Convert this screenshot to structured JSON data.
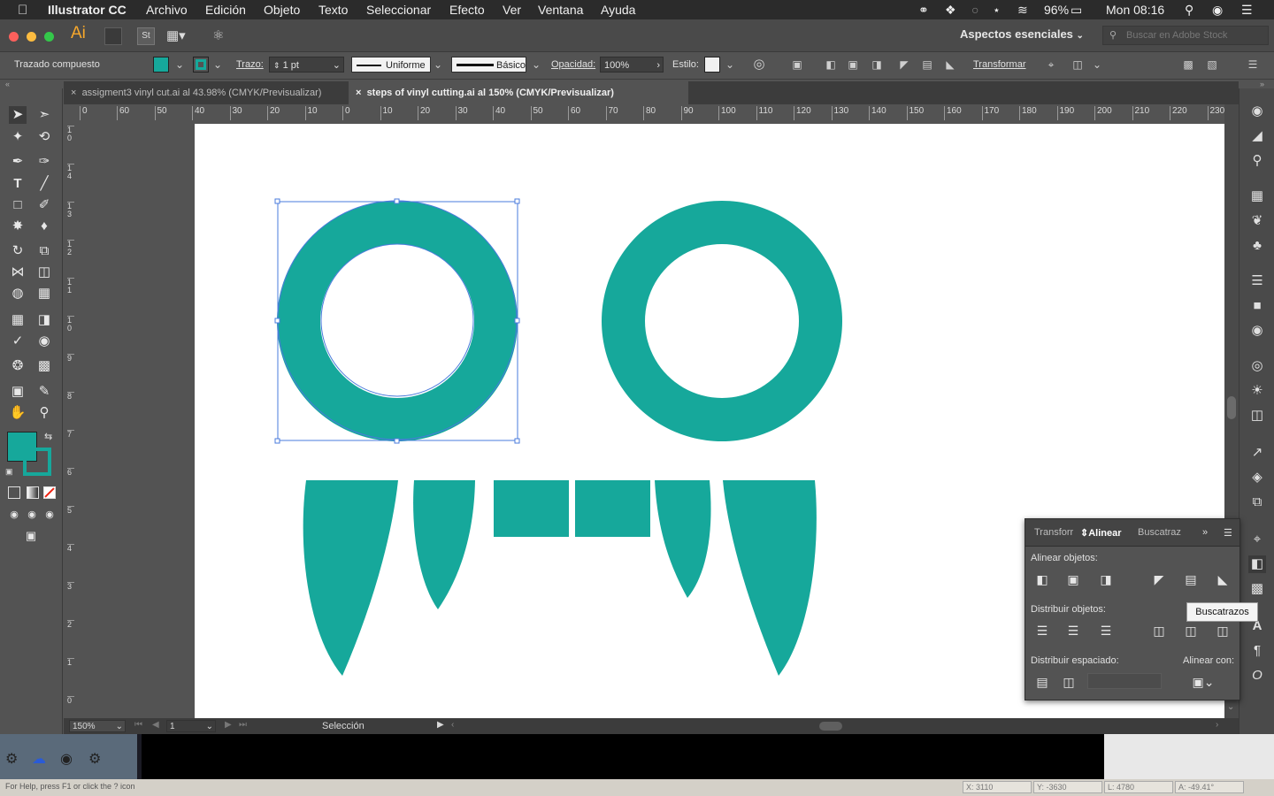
{
  "menubar": {
    "app": "Illustrator CC",
    "items": [
      "Archivo",
      "Edición",
      "Objeto",
      "Texto",
      "Seleccionar",
      "Efecto",
      "Ver",
      "Ventana",
      "Ayuda"
    ],
    "battery": "96%",
    "clock": "Mon 08:16"
  },
  "appbar": {
    "logo": "Ai",
    "st_badge": "St",
    "workspace": "Aspectos esenciales",
    "stock_search_placeholder": "Buscar en Adobe Stock"
  },
  "control": {
    "selection_type": "Trazado compuesto",
    "fill_color": "#16a89b",
    "stroke_label": "Trazo:",
    "stroke_weight": "1 pt",
    "stroke_profile": "Uniforme",
    "brush": "Básico",
    "opacity_label": "Opacidad:",
    "opacity": "100%",
    "style_label": "Estilo:",
    "transform_label": "Transformar"
  },
  "tabs": [
    {
      "label": "assigment3 vinyl cut.ai al 43.98% (CMYK/Previsualizar)",
      "active": false
    },
    {
      "label": "steps of vinyl cutting.ai al 150% (CMYK/Previsualizar)",
      "active": true
    }
  ],
  "ruler": {
    "h_ticks": [
      "0",
      "60",
      "50",
      "40",
      "30",
      "20",
      "10",
      "0",
      "10",
      "20",
      "30",
      "40",
      "50",
      "60",
      "70",
      "80",
      "90",
      "100",
      "110",
      "120",
      "130",
      "140",
      "150",
      "160",
      "170",
      "180",
      "190",
      "200",
      "210",
      "220",
      "230"
    ],
    "v_ticks": [
      "1 0",
      "1 4",
      "1 3",
      "1 2",
      "1 1",
      "1 0",
      "9",
      "8",
      "7",
      "6",
      "5",
      "4",
      "3",
      "2",
      "1",
      "0"
    ]
  },
  "artwork": {
    "color": "#16a89b"
  },
  "align_panel": {
    "tabs": [
      "Transforr",
      "Alinear",
      "Buscatraz"
    ],
    "align_objects_label": "Alinear objetos:",
    "distribute_objects_label": "Distribuir objetos:",
    "distribute_spacing_label": "Distribuir espaciado:",
    "align_to_label": "Alinear con:"
  },
  "tooltip": "Buscatrazos",
  "status": {
    "zoom": "150%",
    "artboard": "1",
    "tool": "Selección"
  },
  "helpbar": {
    "hint": "For Help, press F1 or click the ? icon",
    "x": "X: 3110",
    "y": "Y: -3630",
    "l": "L: 4780",
    "a": "A: -49.41°"
  }
}
